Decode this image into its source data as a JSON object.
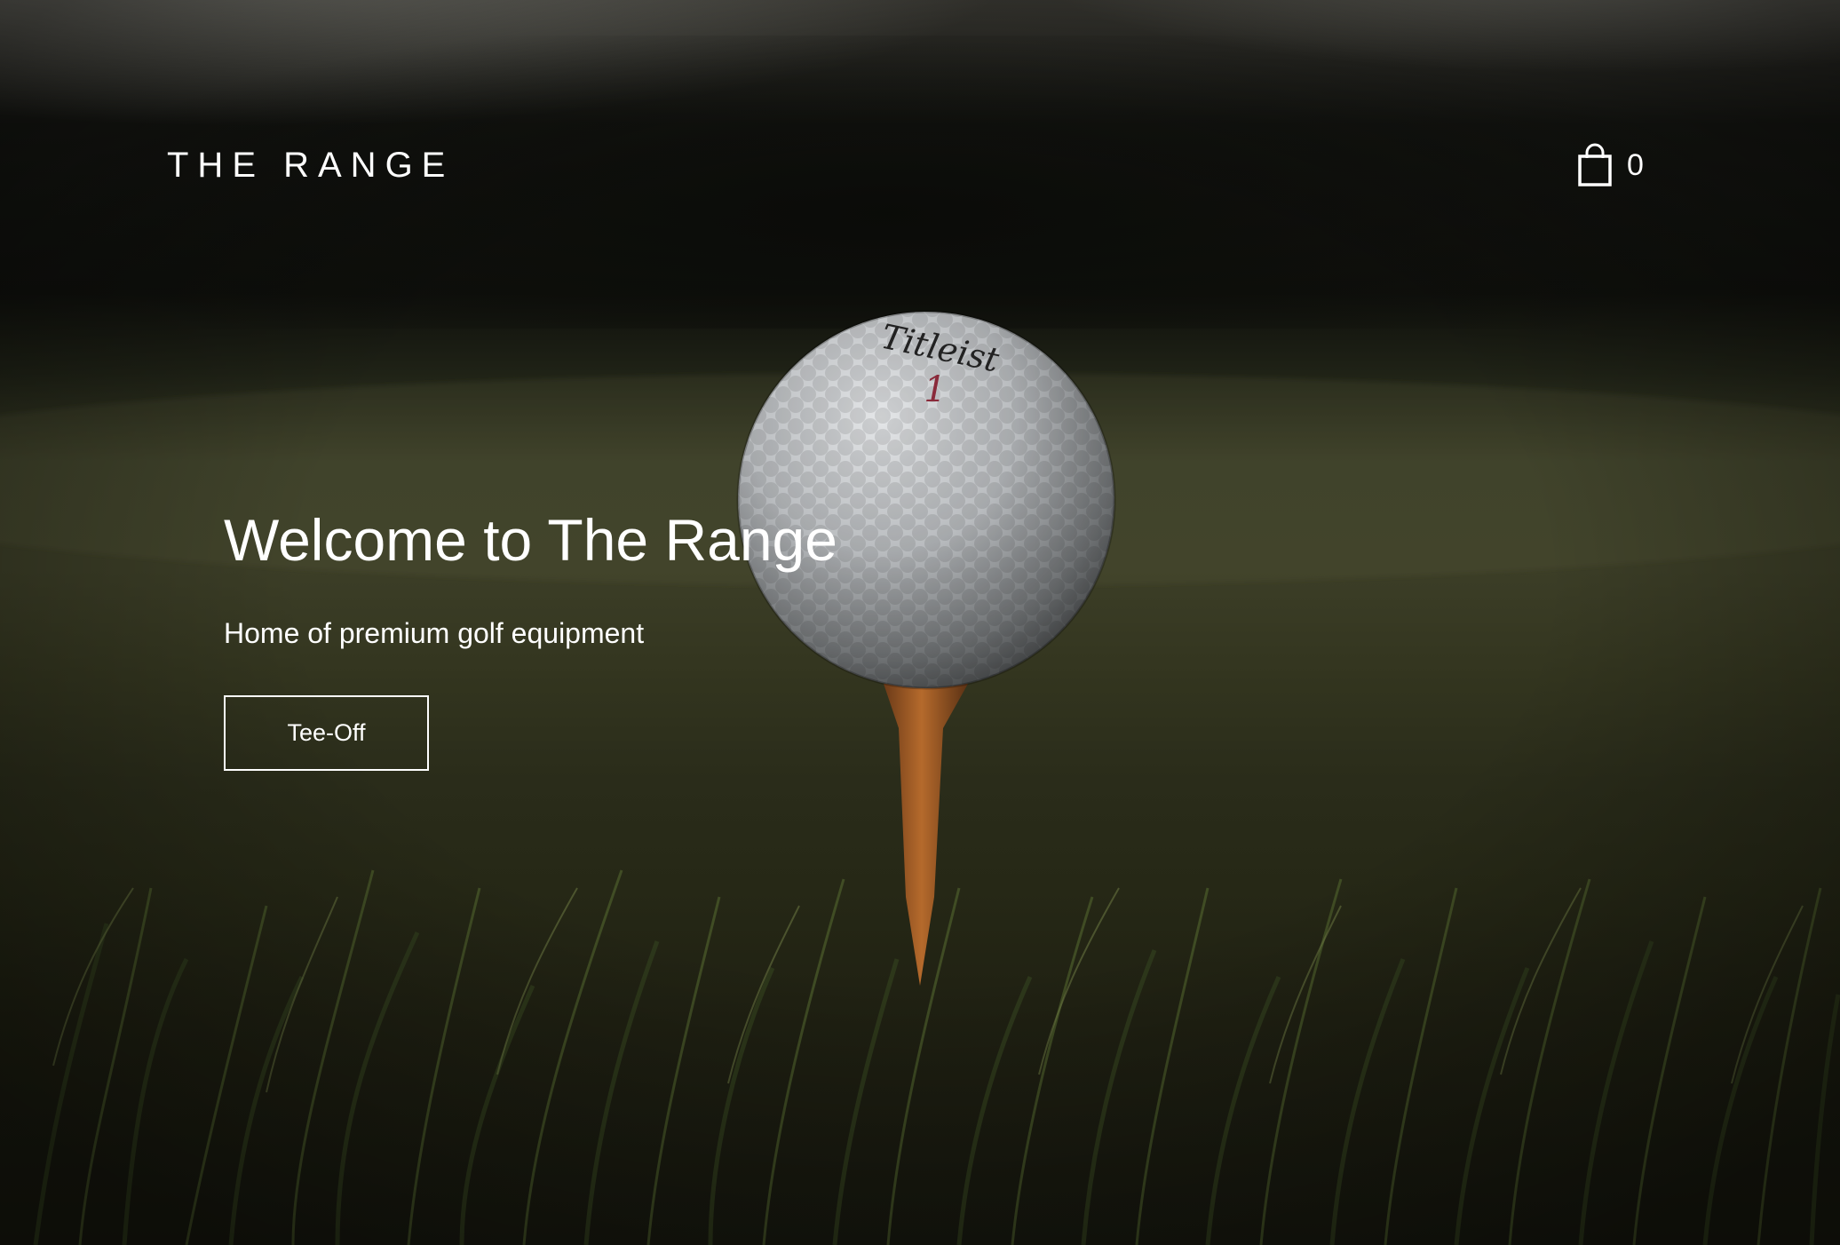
{
  "header": {
    "brand": "THE RANGE",
    "cart_icon": "shopping-bag-icon",
    "cart_count": "0"
  },
  "hero": {
    "title": "Welcome to The Range",
    "subtitle": "Home of premium golf equipment",
    "cta_label": "Tee-Off",
    "background_image": "golf-ball-on-tee-in-grass",
    "ball_brand": "Titleist",
    "ball_number": "1"
  },
  "colors": {
    "text": "#ffffff",
    "background": "#1a1b10"
  }
}
